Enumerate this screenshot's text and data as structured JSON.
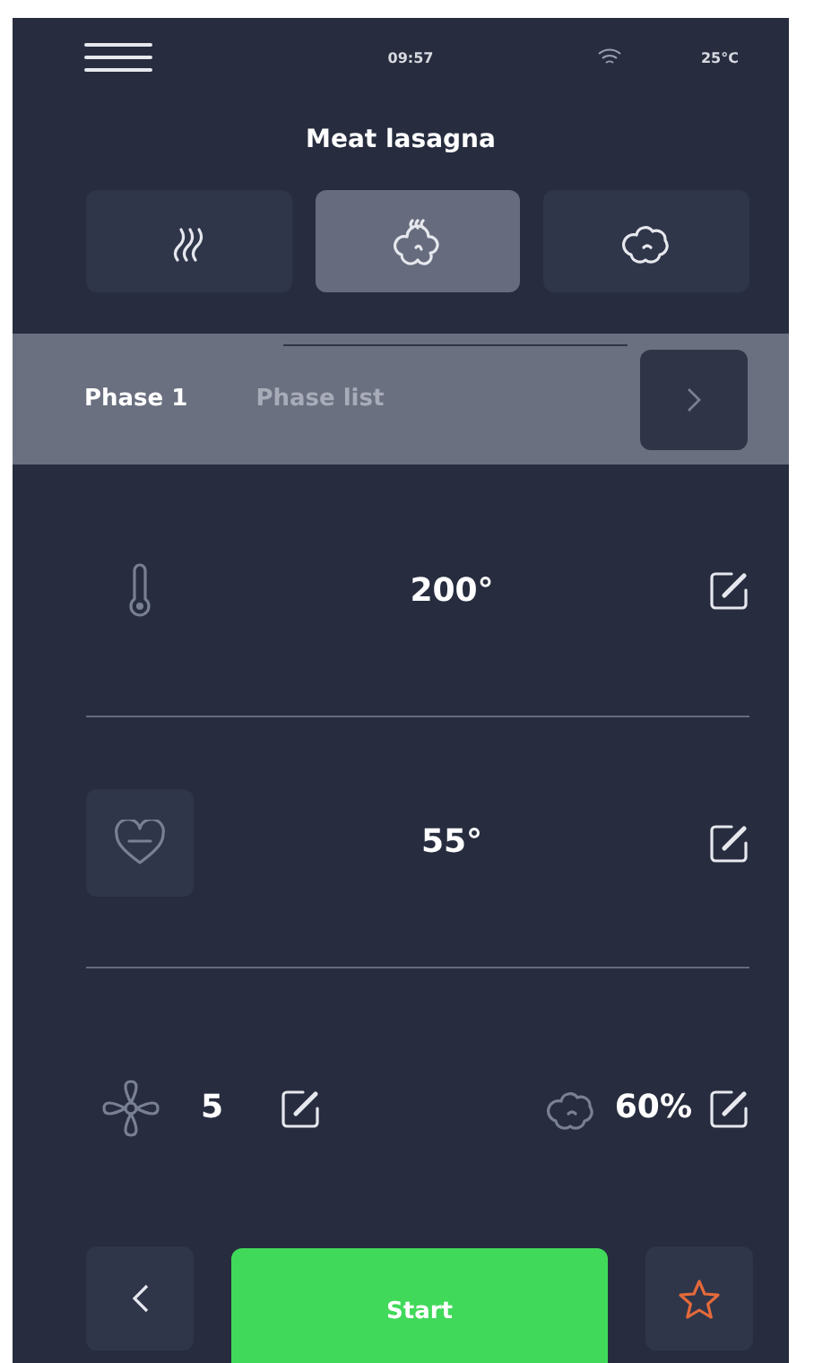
{
  "status_bar": {
    "time": "09:57",
    "temperature": "25°C"
  },
  "title": "Meat lasagna",
  "modes": [
    {
      "kind": "convection",
      "selected": false
    },
    {
      "kind": "steam",
      "selected": true
    },
    {
      "kind": "combi",
      "selected": false
    }
  ],
  "phase_bar": {
    "current": "Phase 1",
    "list_label": "Phase list"
  },
  "settings": [
    {
      "kind": "temperature",
      "value": "200°"
    },
    {
      "kind": "core_probe",
      "value": "55°"
    }
  ],
  "bottom_settings": [
    {
      "kind": "fan",
      "value": "5"
    },
    {
      "kind": "humidity",
      "value": "60%"
    }
  ],
  "actions": {
    "start": "Start"
  }
}
